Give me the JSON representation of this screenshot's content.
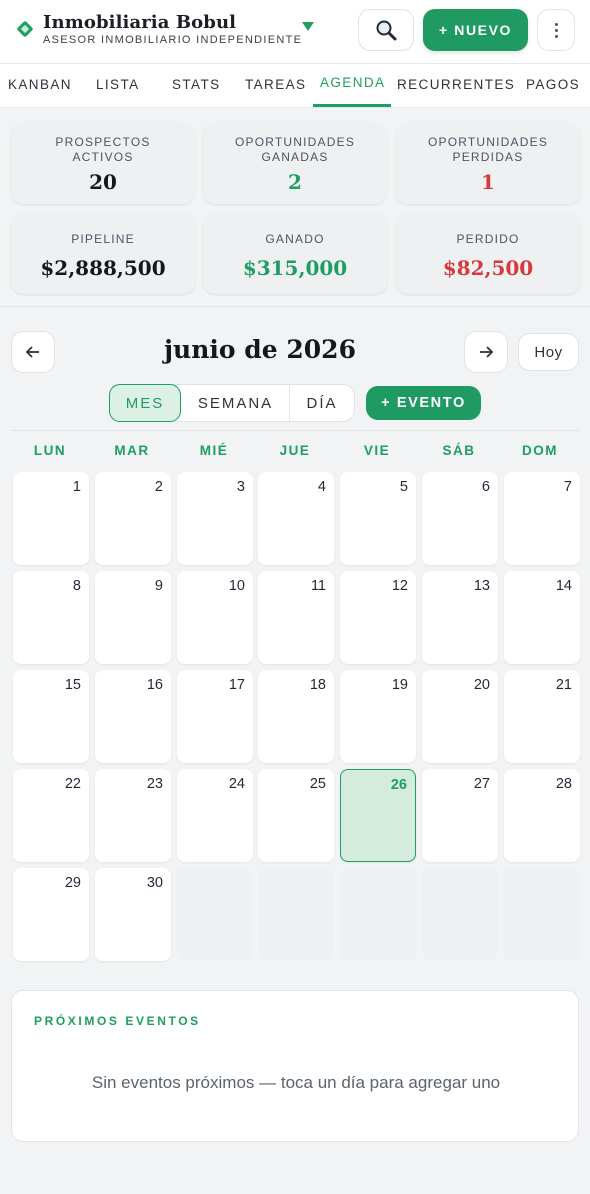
{
  "header": {
    "brand_name": "Inmobiliaria Bobul",
    "brand_subtitle": "ASESOR INMOBILIARIO INDEPENDIENTE",
    "new_button": "+ NUEVO",
    "accent_color": "#1e9e62"
  },
  "tabs": [
    {
      "label": "KANBAN"
    },
    {
      "label": "LISTA"
    },
    {
      "label": "STATS"
    },
    {
      "label": "TAREAS"
    },
    {
      "label": "AGENDA",
      "active": true
    },
    {
      "label": "RECURRENTES"
    },
    {
      "label": "PAGOS"
    }
  ],
  "stats": [
    {
      "label": "PROSPECTOS ACTIVOS",
      "value": "20",
      "color": "#14181d"
    },
    {
      "label": "OPORTUNIDADES GANADAS",
      "value": "2",
      "color": "#1e9e62"
    },
    {
      "label": "OPORTUNIDADES PERDIDAS",
      "value": "1",
      "color": "#d63a3a"
    },
    {
      "label": "PIPELINE",
      "value": "$2,888,500",
      "color": "#14181d"
    },
    {
      "label": "GANADO",
      "value": "$315,000",
      "color": "#1e9e62"
    },
    {
      "label": "PERDIDO",
      "value": "$82,500",
      "color": "#d63a3a"
    }
  ],
  "calendar": {
    "prev_icon": "arrow-left-icon",
    "next_icon": "arrow-right-icon",
    "month_title": "junio de 2026",
    "today_button": "Hoy",
    "views": [
      "MES",
      "SEMANA",
      "DÍA"
    ],
    "active_view": "MES",
    "add_event_button": "+ EVENTO",
    "weekdays": [
      "LUN",
      "MAR",
      "MIÉ",
      "JUE",
      "VIE",
      "SÁB",
      "DOM"
    ],
    "days": [
      "1",
      "2",
      "3",
      "4",
      "5",
      "6",
      "7",
      "8",
      "9",
      "10",
      "11",
      "12",
      "13",
      "14",
      "15",
      "16",
      "17",
      "18",
      "19",
      "20",
      "21",
      "22",
      "23",
      "24",
      "25",
      "26",
      "27",
      "28",
      "29",
      "30",
      "",
      "",
      "",
      "",
      ""
    ],
    "today": "26"
  },
  "upcoming": {
    "title": "PRÓXIMOS EVENTOS",
    "empty_text": "Sin eventos próximos — toca un día para agregar uno"
  }
}
